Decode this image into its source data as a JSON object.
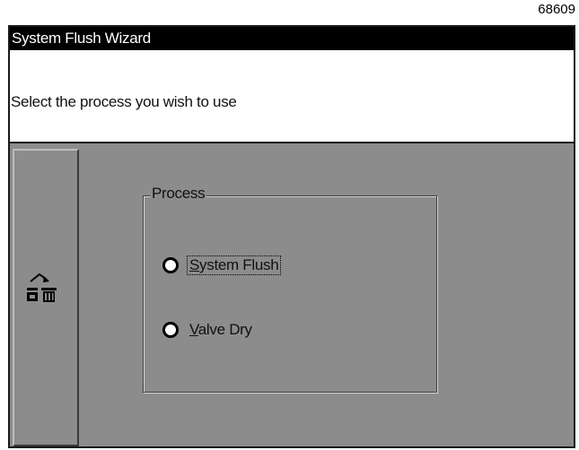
{
  "figure_number": "68609",
  "window": {
    "title": "System Flush Wizard"
  },
  "prompt": {
    "text": "Select the process you wish to use"
  },
  "side_button": {
    "icon": "clear-cartridge-trash-icon"
  },
  "process_group": {
    "legend": "Process",
    "options": [
      {
        "mnemonic": "S",
        "rest": "ystem Flush",
        "focused": true
      },
      {
        "mnemonic": "V",
        "rest": "alve Dry",
        "focused": false
      }
    ]
  },
  "colors": {
    "screen_bg": "#8c8c8c",
    "title_bar": "#000000",
    "prompt_bg": "#ffffff"
  }
}
